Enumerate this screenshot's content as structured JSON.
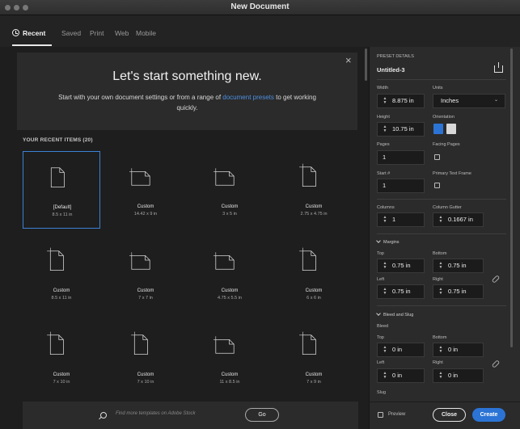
{
  "window": {
    "title": "New Document"
  },
  "tabs": [
    {
      "label": "Recent",
      "active": true
    },
    {
      "label": "Saved"
    },
    {
      "label": "Print"
    },
    {
      "label": "Web"
    },
    {
      "label": "Mobile"
    }
  ],
  "hero": {
    "title": "Let's start something new.",
    "subtitle_before": "Start with your own document settings or from a range of",
    "subtitle_link": "document presets",
    "subtitle_after": "to get working quickly.",
    "close": "×"
  },
  "recent": {
    "heading": "YOUR RECENT ITEMS  (20)",
    "items": [
      {
        "name": "[Default]",
        "dims": "8.5 x 11 in",
        "orientation": "portrait",
        "selected": true
      },
      {
        "name": "Custom",
        "dims": "14.42 x 9 in",
        "orientation": "landscape"
      },
      {
        "name": "Custom",
        "dims": "3 x 5 in",
        "orientation": "landscape"
      },
      {
        "name": "Custom",
        "dims": "2.75 x 4.75 in",
        "orientation": "portrait"
      },
      {
        "name": "Custom",
        "dims": "8.5 x 11 in",
        "orientation": "portrait"
      },
      {
        "name": "Custom",
        "dims": "7 x 7 in",
        "orientation": "landscape"
      },
      {
        "name": "Custom",
        "dims": "4.75 x 5.5 in",
        "orientation": "landscape"
      },
      {
        "name": "Custom",
        "dims": "6 x 6 in",
        "orientation": "portrait"
      },
      {
        "name": "Custom",
        "dims": "7 x 10 in",
        "orientation": "portrait"
      },
      {
        "name": "Custom",
        "dims": "7 x 10 in",
        "orientation": "portrait"
      },
      {
        "name": "Custom",
        "dims": "11 x 8.5 in",
        "orientation": "landscape"
      },
      {
        "name": "Custom",
        "dims": "7 x 9 in",
        "orientation": "portrait"
      }
    ]
  },
  "footer": {
    "search_placeholder": "Find more templates on Adobe Stock",
    "go_label": "Go"
  },
  "panel": {
    "preset_details": "PRESET DETAILS",
    "doc_name": "Untitled-3",
    "width_label": "Width",
    "width_value": "8.875 in",
    "units_label": "Units",
    "units_value": "Inches",
    "height_label": "Height",
    "height_value": "10.75 in",
    "orientation_label": "Orientation",
    "pages_label": "Pages",
    "pages_value": "1",
    "facing_label": "Facing Pages",
    "start_label": "Start #",
    "start_value": "1",
    "ptf_label": "Primary Text Frame",
    "columns_label": "Columns",
    "columns_value": "1",
    "gutter_label": "Column Gutter",
    "gutter_value": "0.1667 in",
    "margins_label": "Margins",
    "top_label": "Top",
    "top_value": "0.75 in",
    "bottom_label": "Bottom",
    "bottom_value": "0.75 in",
    "left_label": "Left",
    "left_value": "0.75 in",
    "right_label": "Right",
    "right_value": "0.75 in",
    "bleed_slug_label": "Bleed and Slug",
    "bleed_label": "Bleed",
    "b_top_label": "Top",
    "b_top_value": "0 in",
    "b_bottom_label": "Bottom",
    "b_bottom_value": "0 in",
    "b_left_label": "Left",
    "b_left_value": "0 in",
    "b_right_label": "Right",
    "b_right_value": "0 in",
    "slug_label": "Slug",
    "preview_label": "Preview",
    "cancel_label": "Close",
    "create_label": "Create"
  },
  "colors": {
    "accent": "#2b74d5",
    "link": "#4d8fe0"
  }
}
